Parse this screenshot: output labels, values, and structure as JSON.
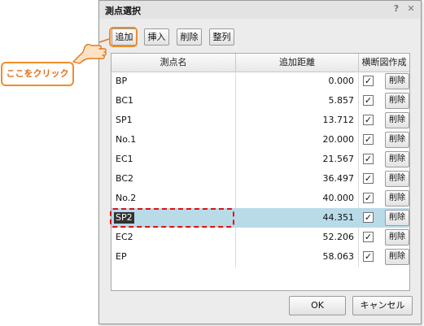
{
  "dialog": {
    "title": "測点選択",
    "help_glyph": "?",
    "close_glyph": "✕"
  },
  "toolbar": {
    "add_label": "追加",
    "insert_label": "挿入",
    "delete_label": "削除",
    "sort_label": "整列"
  },
  "table": {
    "headers": {
      "name": "測点名",
      "distance": "追加距離",
      "cross_section": "横断図作成"
    },
    "delete_label": "削除",
    "check_glyph": "✓",
    "rows": [
      {
        "name": "BP",
        "distance": "0.000",
        "checked": true,
        "selected": false
      },
      {
        "name": "BC1",
        "distance": "5.857",
        "checked": true,
        "selected": false
      },
      {
        "name": "SP1",
        "distance": "13.712",
        "checked": true,
        "selected": false
      },
      {
        "name": "No.1",
        "distance": "20.000",
        "checked": true,
        "selected": false
      },
      {
        "name": "EC1",
        "distance": "21.567",
        "checked": true,
        "selected": false
      },
      {
        "name": "BC2",
        "distance": "36.497",
        "checked": true,
        "selected": false
      },
      {
        "name": "No.2",
        "distance": "40.000",
        "checked": true,
        "selected": false
      },
      {
        "name": "SP2",
        "distance": "44.351",
        "checked": true,
        "selected": true
      },
      {
        "name": "EC2",
        "distance": "52.206",
        "checked": true,
        "selected": false
      },
      {
        "name": "EP",
        "distance": "58.063",
        "checked": true,
        "selected": false
      }
    ]
  },
  "footer": {
    "ok_label": "OK",
    "cancel_label": "キャンセル"
  },
  "annotation": {
    "callout_text": "ここをクリック",
    "accent_color": "#f28c28",
    "highlight_color": "#dd1111"
  },
  "colors": {
    "selected_row": "#b9dbe8"
  }
}
